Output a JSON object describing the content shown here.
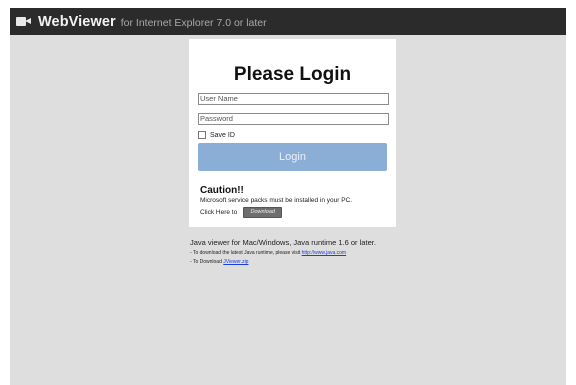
{
  "header": {
    "brand": "WebViewer",
    "subtitle": "for Internet Explorer 7.0 or later",
    "icon": "video-camera-icon"
  },
  "login": {
    "title": "Please Login",
    "username_placeholder": "User Name",
    "password_placeholder": "Password",
    "save_id_label": "Save ID",
    "login_button": "Login",
    "button_color": "#8aaed6"
  },
  "caution": {
    "title": "Caution!!",
    "message": "Microsoft service packs must be installed in your PC.",
    "click_here": "Click Here to",
    "download_button": "Download"
  },
  "java": {
    "title": "Java viewer for Mac/Windows, Java runtime 1.6 or later.",
    "line1_text": "- To download the latest Java runtime, please visit ",
    "line1_link": "http://www.java.com",
    "line2_text": "- To Download ",
    "line2_link": "JViewer.zip"
  }
}
